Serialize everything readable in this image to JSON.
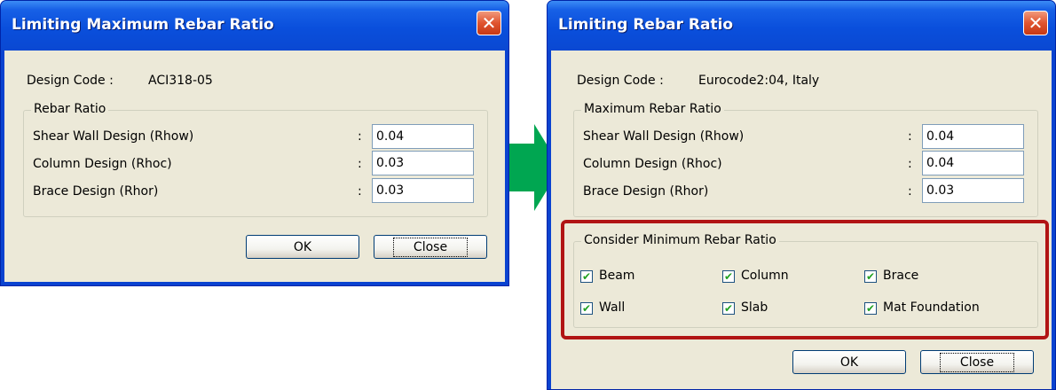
{
  "left": {
    "title": "Limiting Maximum Rebar Ratio",
    "design_code_label": "Design Code :",
    "design_code_value": "ACI318-05",
    "group_title": "Rebar Ratio",
    "rows": [
      {
        "label": "Shear Wall Design (Rhow)",
        "value": "0.04"
      },
      {
        "label": "Column Design (Rhoc)",
        "value": "0.03"
      },
      {
        "label": "Brace Design (Rhor)",
        "value": "0.03"
      }
    ],
    "ok_label": "OK",
    "close_label": "Close"
  },
  "right": {
    "title": "Limiting Rebar Ratio",
    "design_code_label": "Design Code :",
    "design_code_value": "Eurocode2:04, Italy",
    "group_title": "Maximum Rebar Ratio",
    "rows": [
      {
        "label": "Shear Wall Design (Rhow)",
        "value": "0.04"
      },
      {
        "label": "Column Design (Rhoc)",
        "value": "0.04"
      },
      {
        "label": "Brace Design (Rhor)",
        "value": "0.03"
      }
    ],
    "min_group_title": "Consider Minimum Rebar Ratio",
    "checkboxes": [
      {
        "label": "Beam",
        "checked": true
      },
      {
        "label": "Column",
        "checked": true
      },
      {
        "label": "Brace",
        "checked": true
      },
      {
        "label": "Wall",
        "checked": true
      },
      {
        "label": "Slab",
        "checked": true
      },
      {
        "label": "Mat Foundation",
        "checked": true
      }
    ],
    "ok_label": "OK",
    "close_label": "Close"
  },
  "colon": ":",
  "close_glyph": "✕",
  "check_glyph": "✔",
  "colors": {
    "titlebar": "#0a4fdc",
    "dialog_face": "#ece9d8",
    "arrow": "#00a651",
    "highlight": "#b11414"
  },
  "icons": [
    "close-icon",
    "right-arrow-icon",
    "checkmark-icon"
  ]
}
